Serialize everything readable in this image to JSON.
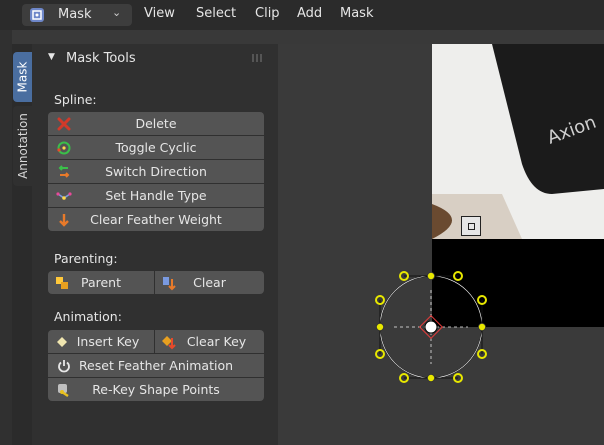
{
  "header": {
    "mode_label": "Mask",
    "menu": [
      "View",
      "Select",
      "Clip",
      "Add",
      "Mask"
    ]
  },
  "tabs": [
    {
      "label": "Mask",
      "active": true
    },
    {
      "label": "Annotation",
      "active": false
    }
  ],
  "panel": {
    "title": "Mask Tools",
    "sections": {
      "spline": {
        "label": "Spline:",
        "buttons": [
          "Delete",
          "Toggle Cyclic",
          "Switch Direction",
          "Set Handle Type",
          "Clear Feather Weight"
        ]
      },
      "parenting": {
        "label": "Parenting:",
        "buttons": [
          "Parent",
          "Clear"
        ]
      },
      "animation": {
        "label": "Animation:",
        "buttons": [
          "Insert Key",
          "Clear Key",
          "Reset Feather Animation",
          "Re-Key Shape Points"
        ]
      }
    }
  },
  "viewport": {
    "photo_text": "Axion"
  },
  "colors": {
    "active_tab": "#4a6ea0",
    "button_bg": "#545454",
    "mask_point": "#e8e800",
    "delete_icon": "#d23a2a"
  }
}
